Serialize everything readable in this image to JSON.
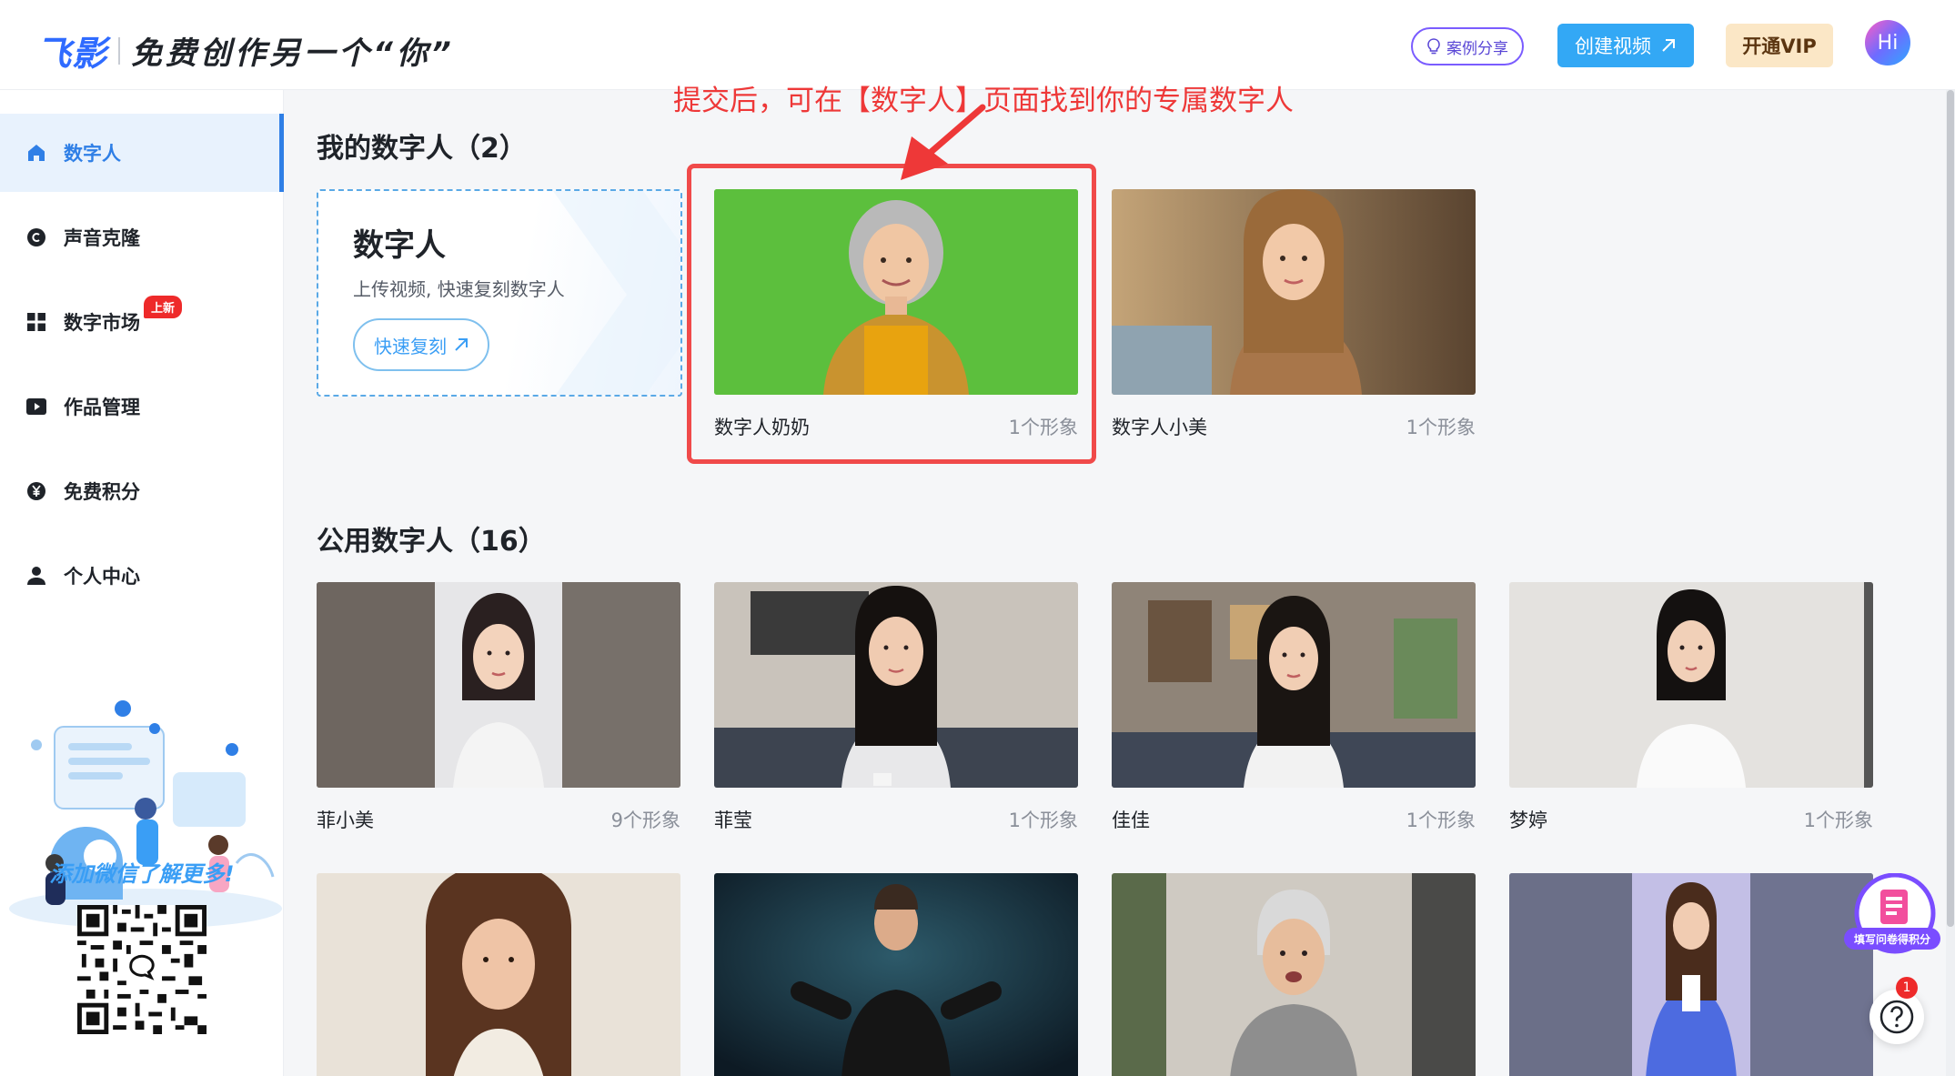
{
  "header": {
    "logo_main": "飞影",
    "logo_slogan": "免费创作另一个“你”",
    "case_share_label": "案例分享",
    "create_video_label": "创建视频",
    "vip_label": "开通VIP",
    "avatar_label": "Hi"
  },
  "sidebar": {
    "items": [
      {
        "label": "数字人",
        "icon": "home-icon",
        "active": true
      },
      {
        "label": "声音克隆",
        "icon": "voice-clone-icon"
      },
      {
        "label": "数字市场",
        "icon": "grid-icon",
        "badge": "上新"
      },
      {
        "label": "作品管理",
        "icon": "video-icon"
      },
      {
        "label": "免费积分",
        "icon": "yen-coin-icon"
      },
      {
        "label": "个人中心",
        "icon": "user-icon"
      }
    ],
    "promo_text": "添加微信了解更多!"
  },
  "annotation": {
    "text": "提交后，可在【数字人】页面找到你的专属数字人",
    "color": "#ee3838"
  },
  "my_avatars": {
    "title": "我的数字人（2）",
    "clone_card": {
      "title": "数字人",
      "subtitle": "上传视频, 快速复刻数字人",
      "button": "快速复刻"
    },
    "items": [
      {
        "name": "数字人奶奶",
        "count": "1个形象"
      },
      {
        "name": "数字人小美",
        "count": "1个形象"
      }
    ]
  },
  "public_avatars": {
    "title": "公用数字人（16）",
    "items": [
      {
        "name": "菲小美",
        "count": "9个形象"
      },
      {
        "name": "菲莹",
        "count": "1个形象"
      },
      {
        "name": "佳佳",
        "count": "1个形象"
      },
      {
        "name": "梦婷",
        "count": "1个形象"
      }
    ]
  },
  "floating": {
    "survey_label": "填写问卷得积分",
    "help_badge": "1"
  },
  "colors": {
    "accent": "#2f7fe6",
    "create_button": "#33a8f5",
    "vip_bg": "#fbe7c6",
    "highlight": "#f04a4a"
  }
}
